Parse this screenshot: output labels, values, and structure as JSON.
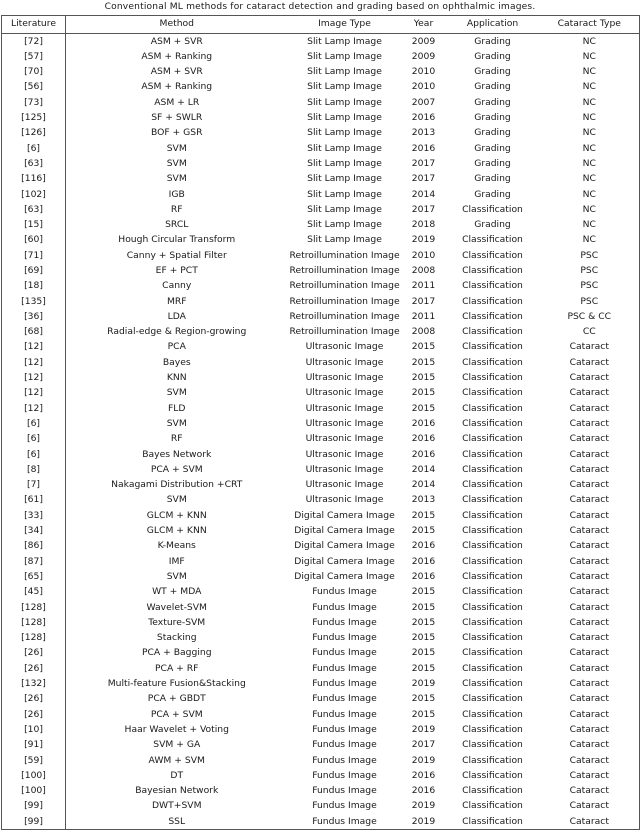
{
  "caption": "Conventional ML methods for cataract detection and grading based on ophthalmic images.",
  "table": {
    "columns": [
      {
        "key": "literature",
        "label": "Literature"
      },
      {
        "key": "method",
        "label": "Method"
      },
      {
        "key": "image_type",
        "label": "Image Type"
      },
      {
        "key": "year",
        "label": "Year"
      },
      {
        "key": "application",
        "label": "Application"
      },
      {
        "key": "cataract_type",
        "label": "Cataract Type"
      }
    ],
    "rows": [
      {
        "literature": "[72]",
        "method": "ASM + SVR",
        "image_type": "Slit Lamp Image",
        "year": "2009",
        "application": "Grading",
        "cataract_type": "NC"
      },
      {
        "literature": "[57]",
        "method": "ASM + Ranking",
        "image_type": "Slit Lamp Image",
        "year": "2009",
        "application": "Grading",
        "cataract_type": "NC"
      },
      {
        "literature": "[70]",
        "method": "ASM + SVR",
        "image_type": "Slit Lamp Image",
        "year": "2010",
        "application": "Grading",
        "cataract_type": "NC"
      },
      {
        "literature": "[56]",
        "method": "ASM + Ranking",
        "image_type": "Slit Lamp Image",
        "year": "2010",
        "application": "Grading",
        "cataract_type": "NC"
      },
      {
        "literature": "[73]",
        "method": "ASM + LR",
        "image_type": "Slit Lamp Image",
        "year": "2007",
        "application": "Grading",
        "cataract_type": "NC"
      },
      {
        "literature": "[125]",
        "method": "SF + SWLR",
        "image_type": "Slit Lamp Image",
        "year": "2016",
        "application": "Grading",
        "cataract_type": "NC"
      },
      {
        "literature": "[126]",
        "method": "BOF + GSR",
        "image_type": "Slit Lamp Image",
        "year": "2013",
        "application": "Grading",
        "cataract_type": "NC"
      },
      {
        "literature": "[6]",
        "method": "SVM",
        "image_type": "Slit Lamp Image",
        "year": "2016",
        "application": "Grading",
        "cataract_type": "NC"
      },
      {
        "literature": "[63]",
        "method": "SVM",
        "image_type": "Slit Lamp Image",
        "year": "2017",
        "application": "Grading",
        "cataract_type": "NC"
      },
      {
        "literature": "[116]",
        "method": "SVM",
        "image_type": "Slit Lamp Image",
        "year": "2017",
        "application": "Grading",
        "cataract_type": "NC"
      },
      {
        "literature": "[102]",
        "method": "IGB",
        "image_type": "Slit Lamp Image",
        "year": "2014",
        "application": "Grading",
        "cataract_type": "NC"
      },
      {
        "literature": "[63]",
        "method": "RF",
        "image_type": "Slit Lamp Image",
        "year": "2017",
        "application": "Classification",
        "cataract_type": "NC"
      },
      {
        "literature": "[15]",
        "method": "SRCL",
        "image_type": "Slit Lamp Image",
        "year": "2018",
        "application": "Grading",
        "cataract_type": "NC"
      },
      {
        "literature": "[60]",
        "method": "Hough Circular Transform",
        "image_type": "Slit Lamp Image",
        "year": "2019",
        "application": "Classification",
        "cataract_type": "NC"
      },
      {
        "literature": "[71]",
        "method": "Canny + Spatial Filter",
        "image_type": "Retroillumination Image",
        "year": "2010",
        "application": "Classification",
        "cataract_type": "PSC"
      },
      {
        "literature": "[69]",
        "method": "EF + PCT",
        "image_type": "Retroillumination Image",
        "year": "2008",
        "application": "Classification",
        "cataract_type": "PSC"
      },
      {
        "literature": "[18]",
        "method": "Canny",
        "image_type": "Retroillumination Image",
        "year": "2011",
        "application": "Classification",
        "cataract_type": "PSC"
      },
      {
        "literature": "[135]",
        "method": "MRF",
        "image_type": "Retroillumination Image",
        "year": "2017",
        "application": "Classification",
        "cataract_type": "PSC"
      },
      {
        "literature": "[36]",
        "method": "LDA",
        "image_type": "Retroillumination Image",
        "year": "2011",
        "application": "Classification",
        "cataract_type": "PSC & CC"
      },
      {
        "literature": "[68]",
        "method": "Radial-edge & Region-growing",
        "image_type": "Retroillumination Image",
        "year": "2008",
        "application": "Classification",
        "cataract_type": "CC"
      },
      {
        "literature": "[12]",
        "method": "PCA",
        "image_type": "Ultrasonic Image",
        "year": "2015",
        "application": "Classification",
        "cataract_type": "Cataract"
      },
      {
        "literature": "[12]",
        "method": "Bayes",
        "image_type": "Ultrasonic Image",
        "year": "2015",
        "application": "Classification",
        "cataract_type": "Cataract"
      },
      {
        "literature": "[12]",
        "method": "KNN",
        "image_type": "Ultrasonic Image",
        "year": "2015",
        "application": "Classification",
        "cataract_type": "Cataract"
      },
      {
        "literature": "[12]",
        "method": "SVM",
        "image_type": "Ultrasonic Image",
        "year": "2015",
        "application": "Classification",
        "cataract_type": "Cataract"
      },
      {
        "literature": "[12]",
        "method": "FLD",
        "image_type": "Ultrasonic Image",
        "year": "2015",
        "application": "Classification",
        "cataract_type": "Cataract"
      },
      {
        "literature": "[6]",
        "method": "SVM",
        "image_type": "Ultrasonic Image",
        "year": "2016",
        "application": "Classification",
        "cataract_type": "Cataract"
      },
      {
        "literature": "[6]",
        "method": "RF",
        "image_type": "Ultrasonic Image",
        "year": "2016",
        "application": "Classification",
        "cataract_type": "Cataract"
      },
      {
        "literature": "[6]",
        "method": "Bayes Network",
        "image_type": "Ultrasonic Image",
        "year": "2016",
        "application": "Classification",
        "cataract_type": "Cataract"
      },
      {
        "literature": "[8]",
        "method": "PCA + SVM",
        "image_type": "Ultrasonic Image",
        "year": "2014",
        "application": "Classification",
        "cataract_type": "Cataract"
      },
      {
        "literature": "[7]",
        "method": "Nakagami Distribution +CRT",
        "image_type": "Ultrasonic Image",
        "year": "2014",
        "application": "Classification",
        "cataract_type": "Cataract"
      },
      {
        "literature": "[61]",
        "method": "SVM",
        "image_type": "Ultrasonic Image",
        "year": "2013",
        "application": "Classification",
        "cataract_type": "Cataract"
      },
      {
        "literature": "[33]",
        "method": "GLCM + KNN",
        "image_type": "Digital Camera Image",
        "year": "2015",
        "application": "Classification",
        "cataract_type": "Cataract"
      },
      {
        "literature": "[34]",
        "method": "GLCM + KNN",
        "image_type": "Digital Camera Image",
        "year": "2015",
        "application": "Classification",
        "cataract_type": "Cataract"
      },
      {
        "literature": "[86]",
        "method": "K-Means",
        "image_type": "Digital Camera Image",
        "year": "2016",
        "application": "Classification",
        "cataract_type": "Cataract"
      },
      {
        "literature": "[87]",
        "method": "IMF",
        "image_type": "Digital Camera Image",
        "year": "2016",
        "application": "Classification",
        "cataract_type": "Cataract"
      },
      {
        "literature": "[65]",
        "method": "SVM",
        "image_type": "Digital Camera Image",
        "year": "2016",
        "application": "Classification",
        "cataract_type": "Cataract"
      },
      {
        "literature": "[45]",
        "method": "WT + MDA",
        "image_type": "Fundus Image",
        "year": "2015",
        "application": "Classification",
        "cataract_type": "Cataract"
      },
      {
        "literature": "[128]",
        "method": "Wavelet-SVM",
        "image_type": "Fundus Image",
        "year": "2015",
        "application": "Classification",
        "cataract_type": "Cataract"
      },
      {
        "literature": "[128]",
        "method": "Texture-SVM",
        "image_type": "Fundus Image",
        "year": "2015",
        "application": "Classification",
        "cataract_type": "Cataract"
      },
      {
        "literature": "[128]",
        "method": "Stacking",
        "image_type": "Fundus Image",
        "year": "2015",
        "application": "Classification",
        "cataract_type": "Cataract"
      },
      {
        "literature": "[26]",
        "method": "PCA + Bagging",
        "image_type": "Fundus Image",
        "year": "2015",
        "application": "Classification",
        "cataract_type": "Cataract"
      },
      {
        "literature": "[26]",
        "method": "PCA + RF",
        "image_type": "Fundus Image",
        "year": "2015",
        "application": "Classification",
        "cataract_type": "Cataract"
      },
      {
        "literature": "[132]",
        "method": "Multi-feature Fusion&Stacking",
        "image_type": "Fundus Image",
        "year": "2019",
        "application": "Classification",
        "cataract_type": "Cataract"
      },
      {
        "literature": "[26]",
        "method": "PCA + GBDT",
        "image_type": "Fundus Image",
        "year": "2015",
        "application": "Classification",
        "cataract_type": "Cataract"
      },
      {
        "literature": "[26]",
        "method": "PCA + SVM",
        "image_type": "Fundus Image",
        "year": "2015",
        "application": "Classification",
        "cataract_type": "Cataract"
      },
      {
        "literature": "[10]",
        "method": "Haar Wavelet + Voting",
        "image_type": "Fundus Image",
        "year": "2019",
        "application": "Classification",
        "cataract_type": "Cataract"
      },
      {
        "literature": "[91]",
        "method": "SVM + GA",
        "image_type": "Fundus Image",
        "year": "2017",
        "application": "Classification",
        "cataract_type": "Cataract"
      },
      {
        "literature": "[59]",
        "method": "AWM + SVM",
        "image_type": "Fundus Image",
        "year": "2019",
        "application": "Classification",
        "cataract_type": "Cataract"
      },
      {
        "literature": "[100]",
        "method": "DT",
        "image_type": "Fundus Image",
        "year": "2016",
        "application": "Classification",
        "cataract_type": "Cataract"
      },
      {
        "literature": "[100]",
        "method": "Bayesian Network",
        "image_type": "Fundus Image",
        "year": "2016",
        "application": "Classification",
        "cataract_type": "Cataract"
      },
      {
        "literature": "[99]",
        "method": "DWT+SVM",
        "image_type": "Fundus Image",
        "year": "2019",
        "application": "Classification",
        "cataract_type": "Cataract"
      },
      {
        "literature": "[99]",
        "method": "SSL",
        "image_type": "Fundus Image",
        "year": "2019",
        "application": "Classification",
        "cataract_type": "Cataract"
      }
    ]
  }
}
